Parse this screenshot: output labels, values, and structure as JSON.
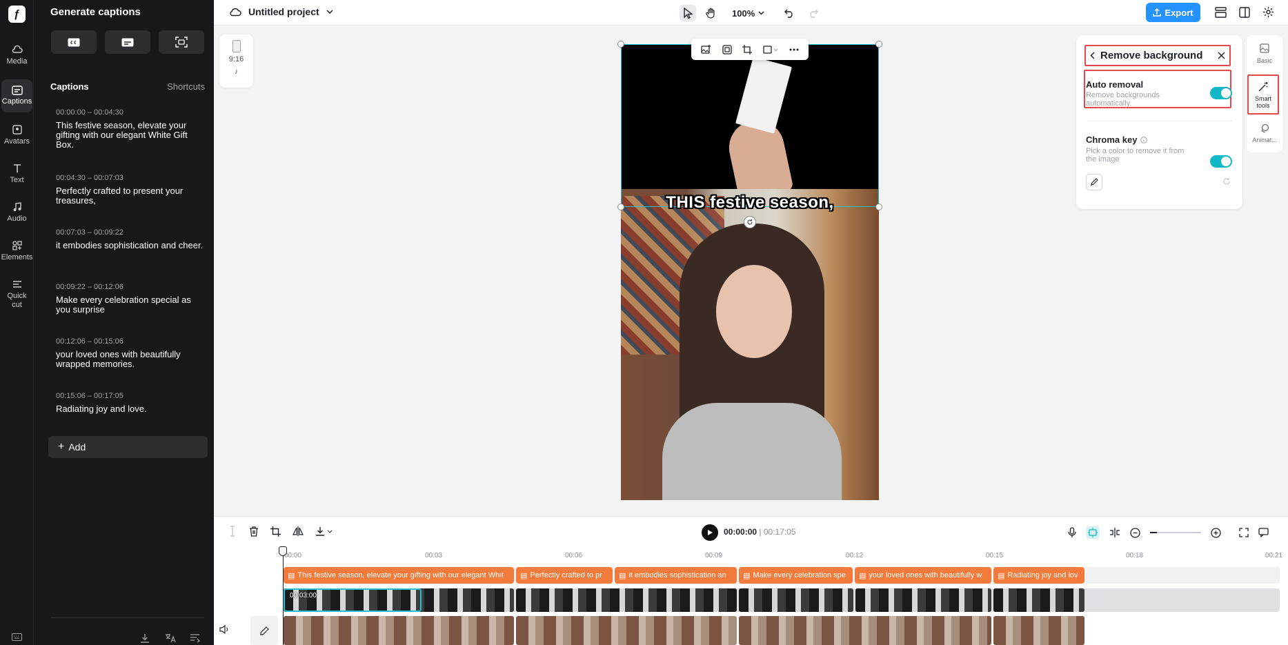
{
  "rail": {
    "items": [
      {
        "label": "Media",
        "icon": "cloud-upload-icon"
      },
      {
        "label": "Captions",
        "icon": "captions-icon"
      },
      {
        "label": "Avatars",
        "icon": "avatar-icon"
      },
      {
        "label": "Text",
        "icon": "text-icon"
      },
      {
        "label": "Audio",
        "icon": "music-icon"
      },
      {
        "label": "Elements",
        "icon": "elements-icon"
      },
      {
        "label": "Quick cut",
        "icon": "quick-cut-icon"
      }
    ]
  },
  "captions_panel": {
    "title": "Generate captions",
    "section_title": "Captions",
    "shortcuts": "Shortcuts",
    "items": [
      {
        "time": "00:00:00 – 00:04:30",
        "text": "This festive season, elevate your gifting with our elegant White Gift Box."
      },
      {
        "time": "00:04:30 – 00:07:03",
        "text": "Perfectly crafted to present your treasures,"
      },
      {
        "time": "00:07:03 – 00:09:22",
        "text": "it embodies sophistication and cheer."
      },
      {
        "time": "00:09:22 – 00:12:06",
        "text": "Make every celebration special as you surprise"
      },
      {
        "time": "00:12:06 – 00:15:06",
        "text": "your loved ones with beautifully wrapped memories."
      },
      {
        "time": "00:15:06 – 00:17:05",
        "text": "Radiating joy and love."
      }
    ],
    "add_label": "Add"
  },
  "topbar": {
    "project_name": "Untitled project",
    "zoom": "100%",
    "export_label": "Export"
  },
  "canvas": {
    "ratio_label": "9:16",
    "caption_overlay": "THIS festive season,"
  },
  "remove_bg": {
    "title": "Remove background",
    "auto_label": "Auto removal",
    "auto_desc": "Remove backgrounds automatically.",
    "auto_on": true,
    "chroma_label": "Chroma key",
    "chroma_desc": "Pick a color to remove it from the image",
    "chroma_on": true
  },
  "right_tabs": [
    {
      "label": "Basic",
      "icon": "image-icon"
    },
    {
      "label": "Smart tools",
      "icon": "magic-wand-icon"
    },
    {
      "label": "Animat...",
      "icon": "animation-icon"
    }
  ],
  "timeline": {
    "current_time": "00:00:00",
    "total_time": "00:17:05",
    "ruler": [
      "00:00",
      "00:03",
      "00:06",
      "00:09",
      "00:12",
      "00:15",
      "00:18",
      "00:21"
    ],
    "caption_clips": [
      "This festive season, elevate your gifting with our elegant Whit",
      "Perfectly crafted to pr",
      "it embodies sophistication an",
      "Make every celebration spe",
      "your loved ones with beautifully w",
      "Radiating joy and lov"
    ],
    "selected_clip_time": "00:03:00"
  },
  "colors": {
    "accent": "#2492ff",
    "teal": "#12b8c6",
    "caption_clip": "#f27a3b",
    "highlight": "#e5484d"
  }
}
